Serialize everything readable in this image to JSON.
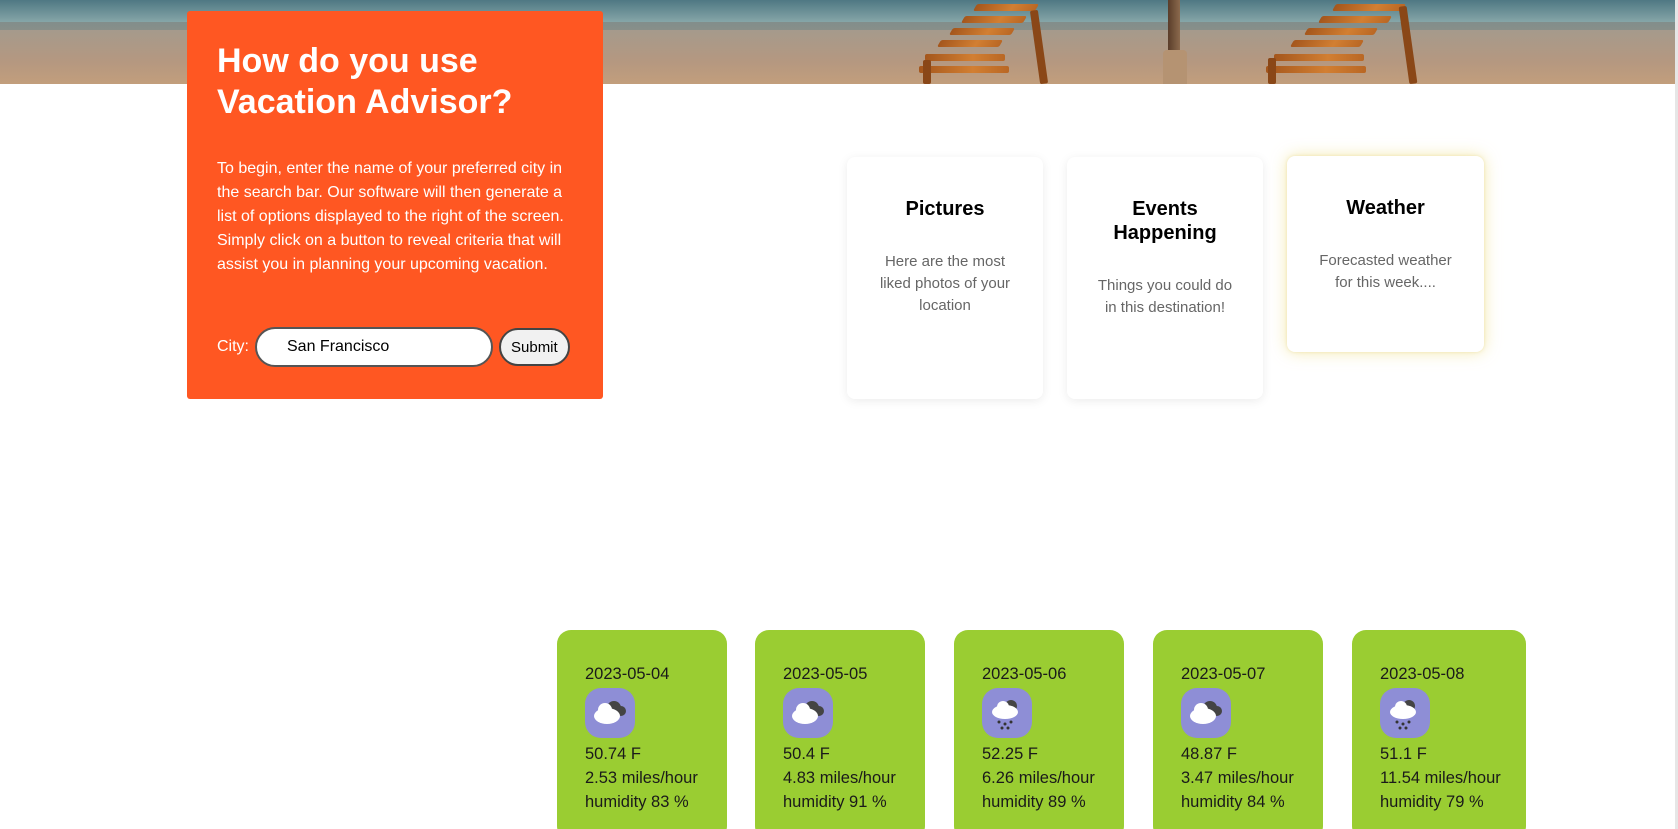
{
  "info": {
    "title": "How do you use Vacation Advisor?",
    "description": "To begin, enter the name of your preferred city in the search bar. Our software will then generate a list of options displayed to the right of the screen. Simply click on a button to reveal criteria that will assist you in planning your upcoming vacation.",
    "city_label": "City:",
    "city_value": "San Francisco",
    "submit_label": "Submit"
  },
  "options": [
    {
      "title": "Pictures",
      "description": "Here are the most liked photos of your location"
    },
    {
      "title": "Events Happening",
      "description": "Things you could do in this destination!"
    },
    {
      "title": "Weather",
      "description": "Forecasted weather for this week...."
    }
  ],
  "forecast": [
    {
      "date": "2023-05-04",
      "icon": "cloudy-icon",
      "temp": "50.74 F",
      "wind": "2.53 miles/hour",
      "humidity": "humidity 83 %"
    },
    {
      "date": "2023-05-05",
      "icon": "cloudy-icon",
      "temp": "50.4 F",
      "wind": "4.83 miles/hour",
      "humidity": "humidity 91 %"
    },
    {
      "date": "2023-05-06",
      "icon": "rain-icon",
      "temp": "52.25 F",
      "wind": "6.26 miles/hour",
      "humidity": "humidity 89 %"
    },
    {
      "date": "2023-05-07",
      "icon": "cloudy-icon",
      "temp": "48.87 F",
      "wind": "3.47 miles/hour",
      "humidity": "humidity 84 %"
    },
    {
      "date": "2023-05-08",
      "icon": "rain-icon",
      "temp": "51.1 F",
      "wind": "11.54 miles/hour",
      "humidity": "humidity 79 %"
    }
  ],
  "colors": {
    "panel": "#ff5722",
    "forecast_card": "#9acd32",
    "icon_bg": "#8e8ed6"
  }
}
